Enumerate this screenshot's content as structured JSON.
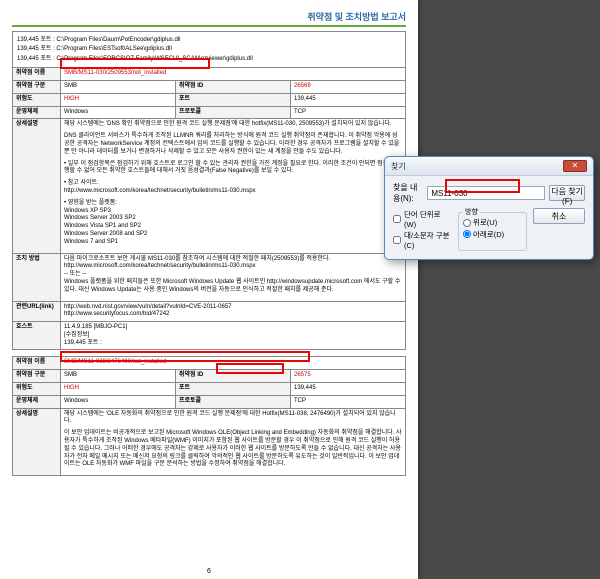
{
  "doc_title": "취약점 및 조치방법 보고서",
  "ports": {
    "l1": "139,445 포트 : C:\\Program Files\\Daum\\PotEncoder\\gdiplus.dll",
    "l2": "139,445 포트 : C:\\Program Files\\ESTsoft\\ALSee\\gdiplus.dll",
    "l3": "139,445 포트 : C:\\Program Files\\FORCS\\OZ Family\\WSECUI_SCAN\\ozviewer\\gdiplus.dll"
  },
  "labels": {
    "name": "취약점 이름",
    "category": "취약점 구분",
    "risk": "위험도",
    "env": "운영체제",
    "desc": "상세설명",
    "fix": "조치 방법",
    "link": "관련URL(link)",
    "host": "호스트",
    "id": "취약점 ID",
    "port": "포트",
    "proto": "프로토콜"
  },
  "vuln1": {
    "name": "SMB/MS11-030/2509553/not_installed",
    "category": "SMB",
    "risk": "HIGH",
    "env": "Windows",
    "id": "26569",
    "port": "139,445",
    "proto": "TCP",
    "desc": {
      "p1": "해당 시스템에는 'DNS 확인 취약점으로 인한 원격 코드 실행 문제점'에 대한 hotfix(MS11-030, 2509553)가 설치되어 있지 않습니다.",
      "p2": "DNS 클라이언트 서비스가 특수하게 조작된 LLMNR 쿼리를 처리하는 방식에 원격 코드 실행 취약점이 존재합니다. 이 취약점 악용에 성공한 공격자는 NetworkService 계정의 컨텍스트에서 임의 코드를 실행할 수 있습니다. 이러한 경우 공격자가 프로그램을 설치할 수 있을 뿐 만 아니라 데이터를 보거나 변경하거나 삭제할 수 있고 모든 사용자 권한이 있는 새 계정을 만들 수도 있습니다.",
      "b1": "• 일부 이 점검항목은 점검하기 위해 호스트로 로그인 할 수 있는 관리자 권한을 가진 계정을 필요로 한다. 이러한 조건이 안되면 점검을 수행할 수 없어 모든 취약한 호스트들에 대해서 거짓 음성결과(False Negative)를 보일 수 있다.",
      "ref_t": "• 참고 사이트:",
      "ref_u": "http://www.microsoft.com/korea/technet/security/bulletin/ms11-030.mspx",
      "aff_t": "• 영향을 받는 플랫폼:",
      "aff1": "Windows XP SP3",
      "aff2": "Windows Server 2003 SP2",
      "aff3": "Windows Vista SP1 and SP2",
      "aff4": "Windows Server 2008 and SP2",
      "aff5": "Windows 7 and SP1"
    },
    "fix": {
      "p1": "다음 마이크로소프트 보안 게시물 MS11-030를 참조하여 시스템에 대한 적절한 패치(2509553)를 적용한다.",
      "u1": "http://www.microsoft.com/korea/technet/security/bulletin/ms11-030.mspx",
      "sep": "-- 또는 --",
      "p2": "Windows 플랫폼을 위한 패치들은 또한 Microsoft Windows Update 웹 사이트인 http://windowsupdate.microsoft.com 에서도 구할 수 있다. 대신 Windows Update는 사용 중인 Windows의 버전을 자동으로 인식하고 적절한 패치를 제공해 준다."
    },
    "link": {
      "u1_a": "http://web.nvd.nist.gov/view/vuln/detail?vulnId=",
      "u1_b": "CVE-2011-0657",
      "u2": "http://www.securityfocus.com/bid/47242"
    },
    "host": {
      "l1": "11.4.9.185 [MBJO-PC1]",
      "l2": "[수집정보]",
      "l3": "139,445 포트 :"
    }
  },
  "vuln2": {
    "name": "SMB/MS11-038/2476490/not_installed",
    "category": "SMB",
    "risk": "HIGH",
    "env": "Windows",
    "id": "26575",
    "port": "139,445",
    "proto": "TCP",
    "desc": {
      "p1": "해당 시스템에는 'OLE 자동화의 취약점으로 인한 원격 코드 실행 문제점'에 대한 Hotfix(MS11-038, 2476490)가 설치되어 있지 않습니다.",
      "p2": "이 보안 업데이트는 비공개적으로 보고된 Microsoft Windows OLE(Object Linking and Embedding) 자동화의 취약점을 해결합니다. 사용자가 특수하게 조작된 Windows 메타파일(WMF) 이미지가 포함된 웹 사이트를 방문할 경우 이 취약점으로 인해 원격 코드 실행이 허용될 수 있습니다. 그러나 어떠한 경우에도 공격자는 강제로 사용자가 이러한 웹 사이트를 방문하도록 만들 수 없습니다. 대신 공격자는 사용자가 전자 메일 메시지 또는 메신저 요청의 링크를 클릭하여 악의적인 웹 사이트를 방문하도록 유도하는 것이 일반적입니다. 이 보안 업데이트는 OLE 자동화가 WMF 파일을 구문 분석하는 방법을 수정하여 취약점을 해결합니다."
    }
  },
  "page_num": "6",
  "dialog": {
    "title": "찾기",
    "find_label": "찾을 내용(N):",
    "find_value": "MS11-030",
    "next": "다음 찾기(F)",
    "cancel": "취소",
    "whole_word": "단어 단위로(W)",
    "match_case": "대/소문자 구분(C)",
    "dir_label": "방향",
    "dir_up": "위로(U)",
    "dir_down": "아래로(D)"
  }
}
